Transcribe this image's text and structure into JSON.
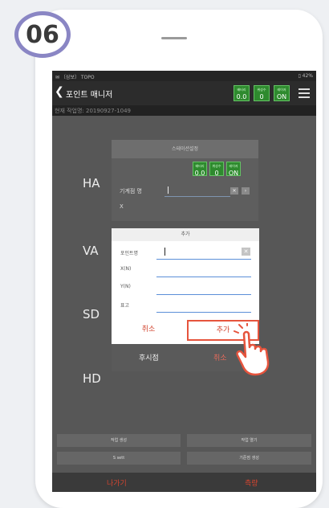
{
  "step_number": "06",
  "status_bar": {
    "left": "✉ 〔삼보〕 TOPO",
    "right": "▯ 42%"
  },
  "header": {
    "title": "포인트 매니저"
  },
  "indicators": [
    {
      "label": "배터리",
      "value": "0.0"
    },
    {
      "label": "위성수",
      "value": "0"
    },
    {
      "label": "레이저",
      "value": "ON"
    }
  ],
  "job": {
    "text": "현재 작업명: 20190927-1049"
  },
  "side_labels": {
    "ha": "HA",
    "va": "VA",
    "sd": "SD",
    "hd": "HD"
  },
  "panel": {
    "strip_label": "스테이션설정",
    "instrument_label": "기계점 명",
    "instrument_value": "",
    "x_label": "X"
  },
  "dialog": {
    "title": "추가",
    "fields": [
      {
        "label": "포인트명",
        "value": ""
      },
      {
        "label": "X(N)",
        "value": ""
      },
      {
        "label": "Y(N)",
        "value": ""
      },
      {
        "label": "표고",
        "value": ""
      }
    ],
    "cancel_label": "취소",
    "add_label": "추가"
  },
  "below_dialog": {
    "backsight_label": "후시점",
    "cancel_label": "취소"
  },
  "bottom_buttons": [
    {
      "label": "작업 생성"
    },
    {
      "label": "작업 열기"
    },
    {
      "label": "S sett"
    },
    {
      "label": "기준점 생성"
    }
  ],
  "footer": {
    "exit_label": "나가기",
    "measure_label": "측량"
  },
  "colors": {
    "frame_accent": "#8a86c4",
    "highlight": "#e6543d",
    "indicator_green": "#2e8a2e",
    "input_underline": "#5b8fd8"
  }
}
